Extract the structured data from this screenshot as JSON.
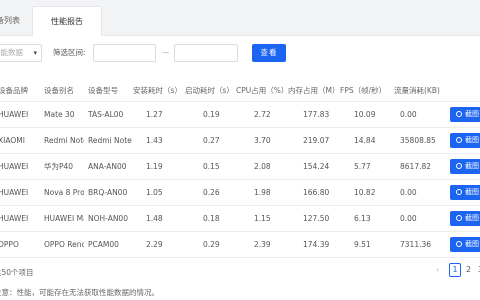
{
  "tabs": [
    {
      "label": "设备列表"
    },
    {
      "label": "性能报告"
    }
  ],
  "filter": {
    "select_placeholder": "性能数据",
    "range_label": "筛选区间:",
    "range_separator": "—",
    "query_label": "查看"
  },
  "table": {
    "headers": [
      "设备品牌",
      "设备别名",
      "设备型号",
      "安装耗时（s）",
      "启动耗时（s）",
      "CPU占用（%）",
      "内存占用（M）",
      "FPS（帧/秒）",
      "流量消耗(KB)",
      ""
    ],
    "rows": [
      {
        "brand": "HUAWEI",
        "alias": "Mate 30",
        "model": "TAS-AL00",
        "install": "1.27",
        "launch": "0.19",
        "cpu": "2.72",
        "mem": "177.83",
        "fps": "10.09",
        "traffic": "0.00",
        "action": "截图"
      },
      {
        "brand": "XIAOMI",
        "alias": "Redmi Note 8 ...",
        "model": "Redmi Note 8 ...",
        "install": "1.43",
        "launch": "0.27",
        "cpu": "3.70",
        "mem": "219.07",
        "fps": "14.84",
        "traffic": "35808.85",
        "action": "截图"
      },
      {
        "brand": "HUAWEI",
        "alias": "华为P40",
        "model": "ANA-AN00",
        "install": "1.19",
        "launch": "0.15",
        "cpu": "2.08",
        "mem": "154.24",
        "fps": "5.77",
        "traffic": "8617.82",
        "action": "截图"
      },
      {
        "brand": "HUAWEI",
        "alias": "Nova 8 Pro",
        "model": "BRQ-AN00",
        "install": "1.05",
        "launch": "0.26",
        "cpu": "1.98",
        "mem": "166.80",
        "fps": "10.82",
        "traffic": "0.00",
        "action": "截图"
      },
      {
        "brand": "HUAWEI",
        "alias": "HUAWEI Mate ...",
        "model": "NOH-AN00",
        "install": "1.48",
        "launch": "0.18",
        "cpu": "1.15",
        "mem": "127.50",
        "fps": "6.13",
        "traffic": "0.00",
        "action": "截图"
      },
      {
        "brand": "OPPO",
        "alias": "OPPO Reno",
        "model": "PCAM00",
        "install": "2.29",
        "launch": "0.29",
        "cpu": "2.39",
        "mem": "174.39",
        "fps": "9.51",
        "traffic": "7311.36",
        "action": "截图"
      }
    ]
  },
  "footer": {
    "total_text": "共50个项目",
    "pages": [
      "1",
      "2",
      "3"
    ],
    "prev": "‹",
    "note": "注意：性能，可能存在无法获取性能数据的情况。"
  },
  "colors": {
    "accent": "#1c64f2",
    "tab_bg": "#f2f3f5"
  },
  "icons": {
    "dropdown": "chevron-down-icon",
    "screenshot": "search-icon"
  }
}
